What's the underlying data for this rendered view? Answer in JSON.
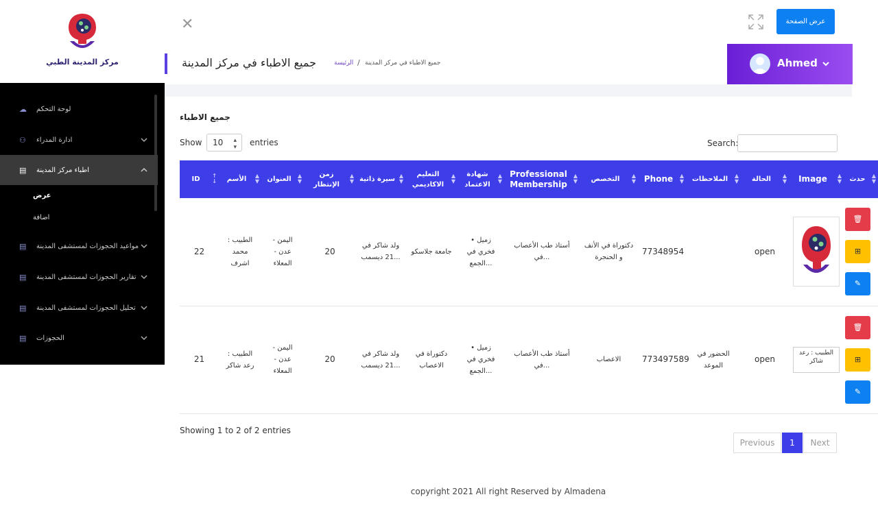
{
  "brand": {
    "name": "مركز المدينة الطبي"
  },
  "sidebar": {
    "items": [
      {
        "label": "لوحة التحكم",
        "icon": "cloud-icon",
        "chevron": false
      },
      {
        "label": "ادارة المدراء",
        "icon": "user-icon",
        "chevron": true
      },
      {
        "label": "اطباء مركز المدينة",
        "icon": "document-icon",
        "chevron": true,
        "active": true
      },
      {
        "label": "مواعيد الحجوزات لمستشفى المدينة",
        "icon": "document-icon",
        "chevron": true
      },
      {
        "label": "تقارير الحجوزات لمستشفى المدينة",
        "icon": "document-icon",
        "chevron": true
      },
      {
        "label": "تحليل الحجوزات لمستشفى المدينة",
        "icon": "document-icon",
        "chevron": true
      },
      {
        "label": "الحجوزات",
        "icon": "document-icon",
        "chevron": true
      }
    ],
    "subitems": [
      {
        "label": "عرض",
        "active": true
      },
      {
        "label": "اضافة",
        "active": false
      }
    ]
  },
  "topbar": {
    "view_label": "عرض الصفحة"
  },
  "header": {
    "title": "جميع الاطباء في مركز المدينة",
    "breadcrumb_home": "الرئيسة",
    "breadcrumb_sep": "/",
    "breadcrumb_current": "جميع الاطباء في مركز المدينة"
  },
  "user": {
    "name": "Ahmed"
  },
  "card": {
    "title": "جميع الاطباء"
  },
  "controls": {
    "show": "Show",
    "length": "10",
    "entries": "entries",
    "search": "Search:"
  },
  "table": {
    "columns": [
      "ID",
      "الأسم",
      "العنوان",
      "زمن الإنتظار",
      "سيرة ذاتية",
      "التعليم الاكاديمي",
      "شهادة الاعتماد",
      "Professional Membership",
      "التخصص",
      "Phone",
      "الملاحظات",
      "الحالة",
      "Image",
      "حدث"
    ],
    "rows": [
      {
        "id": "22",
        "name": "الطبيب : محمد اشرف",
        "address": "اليمن - عدن - المعلاء",
        "wait": "20",
        "cv": "ولد شاكر في 21 ديسمب...",
        "edu": "جامعة جلاسكو",
        "cert": "زميل • فخري في الجمع...",
        "membership": "أستاذ طب الأعصاب في...",
        "specialty": "دكتوراة في الأنف و الحنجرة",
        "phone": "77348954",
        "notes": "",
        "status": "open",
        "image_alt": ""
      },
      {
        "id": "21",
        "name": "الطبيب : رعد شاكر",
        "address": "اليمن - عدن - المعلاء",
        "wait": "20",
        "cv": "ولد شاكر في 21 ديسمب...",
        "edu": "دكتوراة في الاعصاب",
        "cert": "زميل • فخري في الجمع...",
        "membership": "أستاذ طب الأعصاب في...",
        "specialty": "الاعصاب",
        "phone": "773497589",
        "notes": "الحضور في الموعد",
        "status": "open",
        "image_alt": "الطبيب : رعد شاكر"
      }
    ]
  },
  "footer_info": {
    "showing": "Showing 1 to 2 of 2 entries",
    "prev": "Previous",
    "page": "1",
    "next": "Next"
  },
  "copyright": "copyright 2021 All right Reserved by Almadena",
  "colors": {
    "primary": "#3e3ee8",
    "danger": "#e53c4a",
    "warning": "#ffc000",
    "info": "#0d80f2",
    "accent": "#6a1fd6"
  }
}
